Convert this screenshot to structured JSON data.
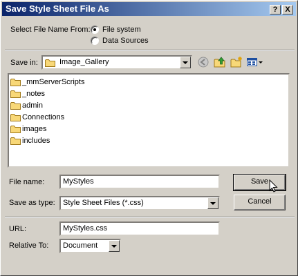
{
  "window": {
    "title": "Save Style Sheet File As"
  },
  "titlebar": {
    "help_label": "?",
    "close_label": "X"
  },
  "select_from": {
    "label": "Select File Name From:",
    "options": [
      "File system",
      "Data Sources"
    ],
    "selected": "File system"
  },
  "save_in": {
    "label": "Save in:",
    "value": "Image_Gallery"
  },
  "files": {
    "items": [
      "_mmServerScripts",
      "_notes",
      "admin",
      "Connections",
      "images",
      "includes"
    ]
  },
  "file_name": {
    "label": "File name:",
    "value": "MyStyles"
  },
  "save_as_type": {
    "label": "Save as type:",
    "value": "Style Sheet Files (*.css)"
  },
  "url": {
    "label": "URL:",
    "value": "MyStyles.css"
  },
  "relative_to": {
    "label": "Relative To:",
    "value": "Document"
  },
  "buttons": {
    "save": "Save",
    "cancel": "Cancel"
  },
  "icons": {
    "back": "back-arrow-icon",
    "up": "up-folder-icon",
    "new_folder": "new-folder-icon",
    "view_menu": "view-menu-icon",
    "cursor": "mouse-pointer-icon"
  }
}
